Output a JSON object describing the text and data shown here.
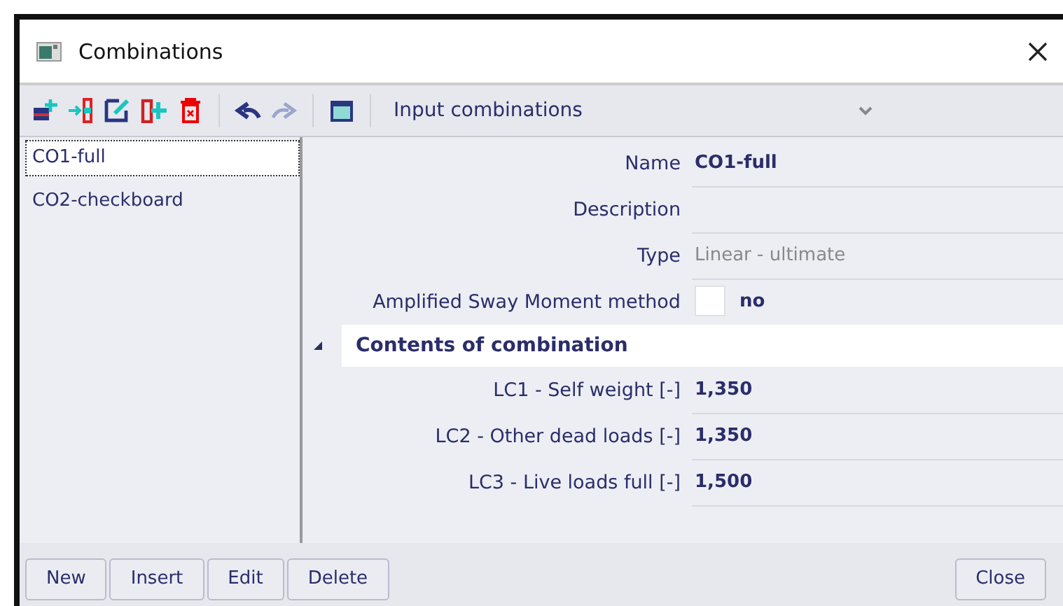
{
  "window": {
    "title": "Combinations"
  },
  "toolbar": {
    "dropdown": "Input combinations"
  },
  "list": [
    {
      "label": "CO1-full",
      "selected": true
    },
    {
      "label": "CO2-checkboard",
      "selected": false
    }
  ],
  "properties": [
    {
      "kind": "text",
      "label": "Name",
      "value": "CO1-full"
    },
    {
      "kind": "text",
      "label": "Description"
    },
    {
      "kind": "readonly",
      "label": "Type",
      "value": "Linear - ultimate"
    },
    {
      "kind": "check",
      "label": "Amplified Sway Moment method",
      "value": "no",
      "checked": false
    }
  ],
  "section": {
    "title": "Contents of combination",
    "expanded": true,
    "rows": [
      {
        "label": "LC1 - Self weight [-]",
        "value": "1,350"
      },
      {
        "label": "LC2 - Other dead loads [-]",
        "value": "1,350"
      },
      {
        "label": "LC3 - Live loads full [-]",
        "value": "1,500"
      }
    ]
  },
  "buttons": [
    {
      "label": "New"
    },
    {
      "label": "Insert"
    },
    {
      "label": "Edit"
    },
    {
      "label": "Delete"
    }
  ],
  "close_button": "Close"
}
